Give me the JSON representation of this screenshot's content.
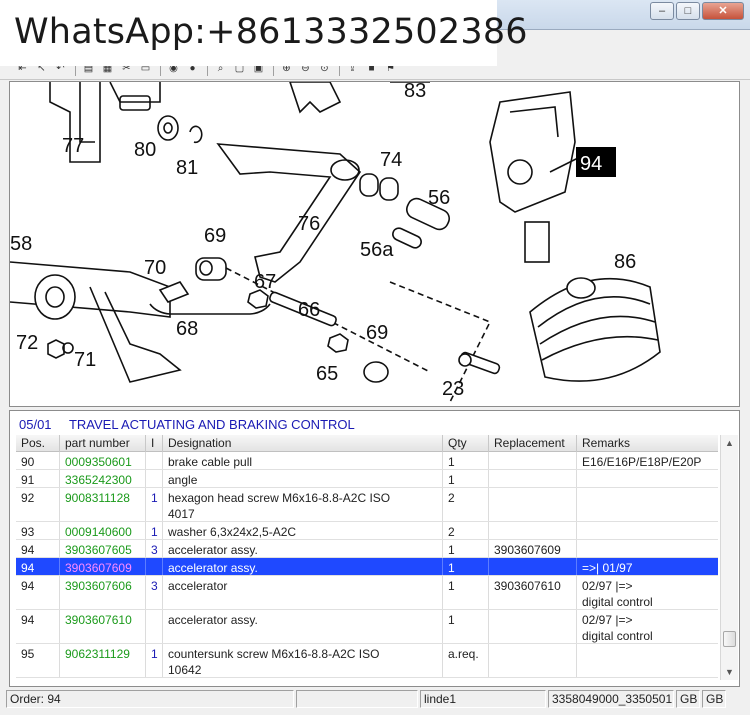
{
  "watermark": "WhatsApp:+8613332502386",
  "window": {
    "min": "‒",
    "max": "□",
    "close": "✕"
  },
  "toolbar_icons": [
    "first-icon",
    "prev-icon",
    "back-icon",
    "print-icon",
    "copy-icon",
    "cut-icon",
    "select-icon",
    "mark-icon",
    "globe-icon",
    "search-icon",
    "page-icon",
    "page2-icon",
    "zoom-in-icon",
    "zoom-out-icon",
    "zoom-fit-icon",
    "export-icon",
    "flag-icon",
    "alert-icon"
  ],
  "drawing": {
    "callouts": [
      {
        "id": "77",
        "text": "77"
      },
      {
        "id": "80",
        "text": "80"
      },
      {
        "id": "81",
        "text": "81"
      },
      {
        "id": "83",
        "text": "83"
      },
      {
        "id": "94",
        "text": "94"
      },
      {
        "id": "74",
        "text": "74"
      },
      {
        "id": "56",
        "text": "56"
      },
      {
        "id": "76",
        "text": "76"
      },
      {
        "id": "56a",
        "text": "56a"
      },
      {
        "id": "58",
        "text": "58"
      },
      {
        "id": "69a",
        "text": "69"
      },
      {
        "id": "70",
        "text": "70"
      },
      {
        "id": "67",
        "text": "67"
      },
      {
        "id": "68",
        "text": "68"
      },
      {
        "id": "66",
        "text": "66"
      },
      {
        "id": "86",
        "text": "86"
      },
      {
        "id": "72",
        "text": "72"
      },
      {
        "id": "71",
        "text": "71"
      },
      {
        "id": "69b",
        "text": "69"
      },
      {
        "id": "65",
        "text": "65"
      },
      {
        "id": "23",
        "text": "23"
      }
    ]
  },
  "section": {
    "code": "05/01",
    "title": "TRAVEL ACTUATING AND BRAKING CONTROL"
  },
  "columns": {
    "pos": "Pos.",
    "part": "part number",
    "i": "I",
    "des": "Designation",
    "qty": "Qty",
    "rep": "Replacement",
    "rem": "Remarks"
  },
  "rows": [
    {
      "pos": "90",
      "part": "0009350601",
      "i": "",
      "des": "brake cable pull",
      "qty": "1",
      "rep": "",
      "rem": "E16/E16P/E18P/E20P"
    },
    {
      "pos": "91",
      "part": "3365242300",
      "i": "",
      "des": "angle",
      "qty": "1",
      "rep": "",
      "rem": ""
    },
    {
      "pos": "92",
      "part": "9008311128",
      "i": "1",
      "des": "hexagon head screw M6x16-8.8-A2C  ISO\n4017",
      "qty": "2",
      "rep": "",
      "rem": ""
    },
    {
      "pos": "93",
      "part": "0009140600",
      "i": "1",
      "des": "washer 6,3x24x2,5-A2C",
      "qty": "2",
      "rep": "",
      "rem": ""
    },
    {
      "pos": "94",
      "part": "3903607605",
      "i": "3",
      "des": "accelerator assy.",
      "qty": "1",
      "rep": "3903607609",
      "rem": ""
    },
    {
      "pos": "94",
      "part": "3903607609",
      "i": "",
      "des": "accelerator assy.",
      "qty": "1",
      "rep": "",
      "rem": "=>| 01/97"
    },
    {
      "pos": "94",
      "part": "3903607606",
      "i": "3",
      "des": "accelerator",
      "qty": "1",
      "rep": "3903607610",
      "rem": "02/97 |=>\ndigital control"
    },
    {
      "pos": "94",
      "part": "3903607610",
      "i": "",
      "des": "accelerator assy.",
      "qty": "1",
      "rep": "",
      "rem": "02/97 |=>\ndigital control"
    },
    {
      "pos": "95",
      "part": "9062311129",
      "i": "1",
      "des": "countersunk screw M6x16-8.8-A2C  ISO\n10642",
      "qty": "a.req.",
      "rep": "",
      "rem": ""
    }
  ],
  "selected_row": 5,
  "status": {
    "order": "Order: 94",
    "empty": "",
    "model": "linde1",
    "range": "3358049000_3350501",
    "lang1": "GB",
    "lang2": "GB"
  },
  "colors": {
    "accent_select": "#1f49ff",
    "part_number": "#1b9a1b",
    "section_title": "#1a1ab4"
  }
}
